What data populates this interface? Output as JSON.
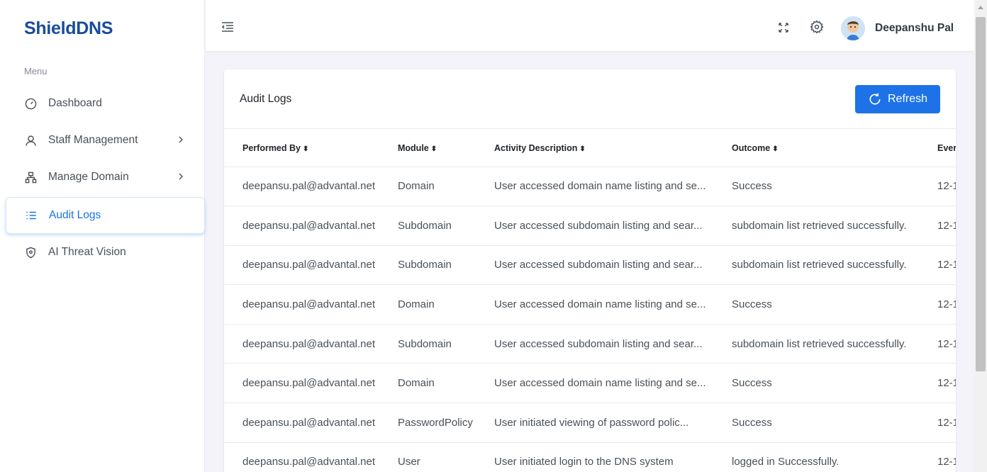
{
  "app": {
    "logo": "ShieldDNS"
  },
  "sidebar": {
    "menu_title": "Menu",
    "items": [
      {
        "label": "Dashboard",
        "icon": "gauge-icon"
      },
      {
        "label": "Staff Management",
        "icon": "user-icon",
        "has_submenu": true
      },
      {
        "label": "Manage Domain",
        "icon": "sitemap-icon",
        "has_submenu": true
      },
      {
        "label": "Audit Logs",
        "icon": "list-icon",
        "active": true
      },
      {
        "label": "AI Threat Vision",
        "icon": "shield-icon"
      }
    ]
  },
  "topbar": {
    "menu_toggle_icon": "menu-fold-icon",
    "fullscreen_icon": "fullscreen-icon",
    "settings_icon": "gear-icon",
    "user_name": "Deepanshu Pal"
  },
  "card": {
    "title": "Audit Logs",
    "refresh_label": "Refresh"
  },
  "table": {
    "sort_glyph": "⬍",
    "columns": [
      "Performed By",
      "Module",
      "Activity Description",
      "Outcome",
      "Ever"
    ],
    "rows": [
      [
        "deepansu.pal@advantal.net",
        "Domain",
        "User accessed domain name listing and se...",
        "Success",
        "12-1"
      ],
      [
        "deepansu.pal@advantal.net",
        "Subdomain",
        "User accessed subdomain listing and sear...",
        "subdomain list retrieved successfully.",
        "12-1"
      ],
      [
        "deepansu.pal@advantal.net",
        "Subdomain",
        "User accessed subdomain listing and sear...",
        "subdomain list retrieved successfully.",
        "12-1"
      ],
      [
        "deepansu.pal@advantal.net",
        "Domain",
        "User accessed domain name listing and se...",
        "Success",
        "12-1"
      ],
      [
        "deepansu.pal@advantal.net",
        "Subdomain",
        "User accessed subdomain listing and sear...",
        "subdomain list retrieved successfully.",
        "12-1"
      ],
      [
        "deepansu.pal@advantal.net",
        "Domain",
        "User accessed domain name listing and se...",
        "Success",
        "12-1"
      ],
      [
        "deepansu.pal@advantal.net",
        "PasswordPolicy",
        "User initiated viewing of password polic...",
        "Success",
        "12-1"
      ],
      [
        "deepansu.pal@advantal.net",
        "User",
        "User initiated login to the DNS system",
        "logged in Successfully.",
        "12-1"
      ]
    ]
  },
  "colors": {
    "brand": "#1a4b9c",
    "accent": "#1d72e8",
    "background": "#f3f3f9"
  }
}
